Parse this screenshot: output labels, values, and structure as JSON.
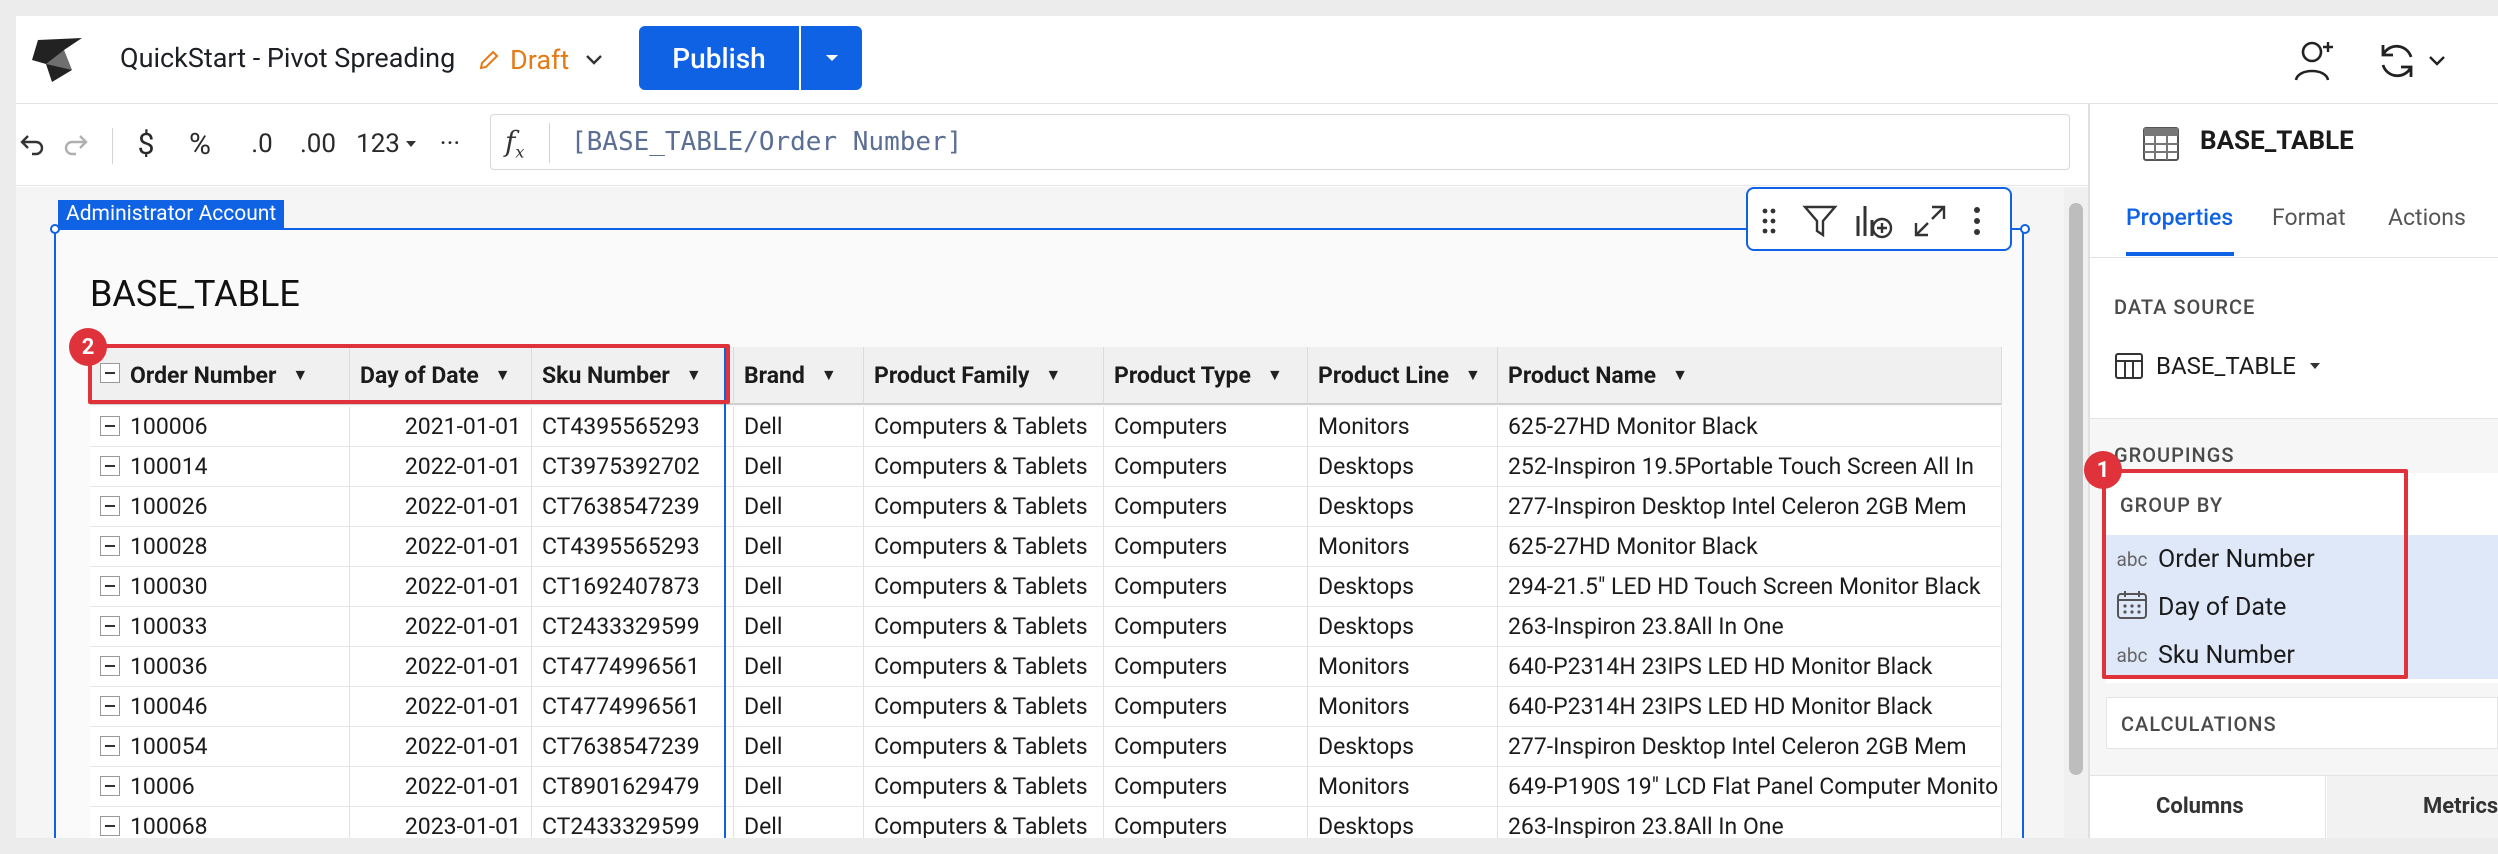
{
  "header": {
    "title": "QuickStart - Pivot Spreading",
    "status": "Draft",
    "publish_label": "Publish"
  },
  "toolbar": {
    "currency": "$",
    "percent": "%",
    "decrease_decimals": ".0",
    "increase_decimals": ".00",
    "number_format": "123",
    "more": "···",
    "formula": "[BASE_TABLE/Order Number]"
  },
  "canvas": {
    "admin_tag": "Administrator Account",
    "table_title": "BASE_TABLE"
  },
  "table": {
    "columns": [
      "Order Number",
      "Day of Date",
      "Sku Number",
      "Brand",
      "Product Family",
      "Product Type",
      "Product Line",
      "Product Name"
    ],
    "rows": [
      [
        "100006",
        "2021-01-01",
        "CT4395565293",
        "Dell",
        "Computers & Tablets",
        "Computers",
        "Monitors",
        "625-27HD Monitor   Black"
      ],
      [
        "100014",
        "2022-01-01",
        "CT3975392702",
        "Dell",
        "Computers & Tablets",
        "Computers",
        "Desktops",
        "252-Inspiron 19.5Portable Touch Screen All In"
      ],
      [
        "100026",
        "2022-01-01",
        "CT7638547239",
        "Dell",
        "Computers & Tablets",
        "Computers",
        "Desktops",
        "277-Inspiron Desktop   Intel Celeron   2GB Mem"
      ],
      [
        "100028",
        "2022-01-01",
        "CT4395565293",
        "Dell",
        "Computers & Tablets",
        "Computers",
        "Monitors",
        "625-27HD Monitor   Black"
      ],
      [
        "100030",
        "2022-01-01",
        "CT1692407873",
        "Dell",
        "Computers & Tablets",
        "Computers",
        "Desktops",
        "294-21.5\" LED HD Touch Screen Monitor   Black"
      ],
      [
        "100033",
        "2022-01-01",
        "CT2433329599",
        "Dell",
        "Computers & Tablets",
        "Computers",
        "Desktops",
        "263-Inspiron 23.8All In One"
      ],
      [
        "100036",
        "2022-01-01",
        "CT4774996561",
        "Dell",
        "Computers & Tablets",
        "Computers",
        "Monitors",
        "640-P2314H 23IPS LED HD Monitor   Black"
      ],
      [
        "100046",
        "2022-01-01",
        "CT4774996561",
        "Dell",
        "Computers & Tablets",
        "Computers",
        "Monitors",
        "640-P2314H 23IPS LED HD Monitor   Black"
      ],
      [
        "100054",
        "2022-01-01",
        "CT7638547239",
        "Dell",
        "Computers & Tablets",
        "Computers",
        "Desktops",
        "277-Inspiron Desktop   Intel Celeron   2GB Mem"
      ],
      [
        "10006",
        "2022-01-01",
        "CT8901629479",
        "Dell",
        "Computers & Tablets",
        "Computers",
        "Monitors",
        "649-P190S 19\" LCD Flat Panel Computer Monito"
      ],
      [
        "100068",
        "2023-01-01",
        "CT2433329599",
        "Dell",
        "Computers & Tablets",
        "Computers",
        "Desktops",
        "263-Inspiron 23.8All In One"
      ]
    ]
  },
  "panel": {
    "element_name": "BASE_TABLE",
    "tabs": [
      "Properties",
      "Format",
      "Actions"
    ],
    "data_source_label": "DATA SOURCE",
    "data_source_value": "BASE_TABLE",
    "groupings_label": "GROUPINGS",
    "group_by_label": "GROUP BY",
    "group_by": [
      {
        "type": "abc",
        "name": "Order Number"
      },
      {
        "type": "date",
        "name": "Day of Date"
      },
      {
        "type": "abc",
        "name": "Sku Number"
      }
    ],
    "calculations_label": "CALCULATIONS",
    "bottom_tabs": [
      "Columns",
      "Metrics"
    ]
  },
  "annotations": {
    "badge_1": "1",
    "badge_2": "2"
  },
  "colors": {
    "accent": "#1062e5",
    "draft": "#e37b17",
    "annotation": "#e0323a",
    "group_highlight": "#dfe8f8"
  }
}
